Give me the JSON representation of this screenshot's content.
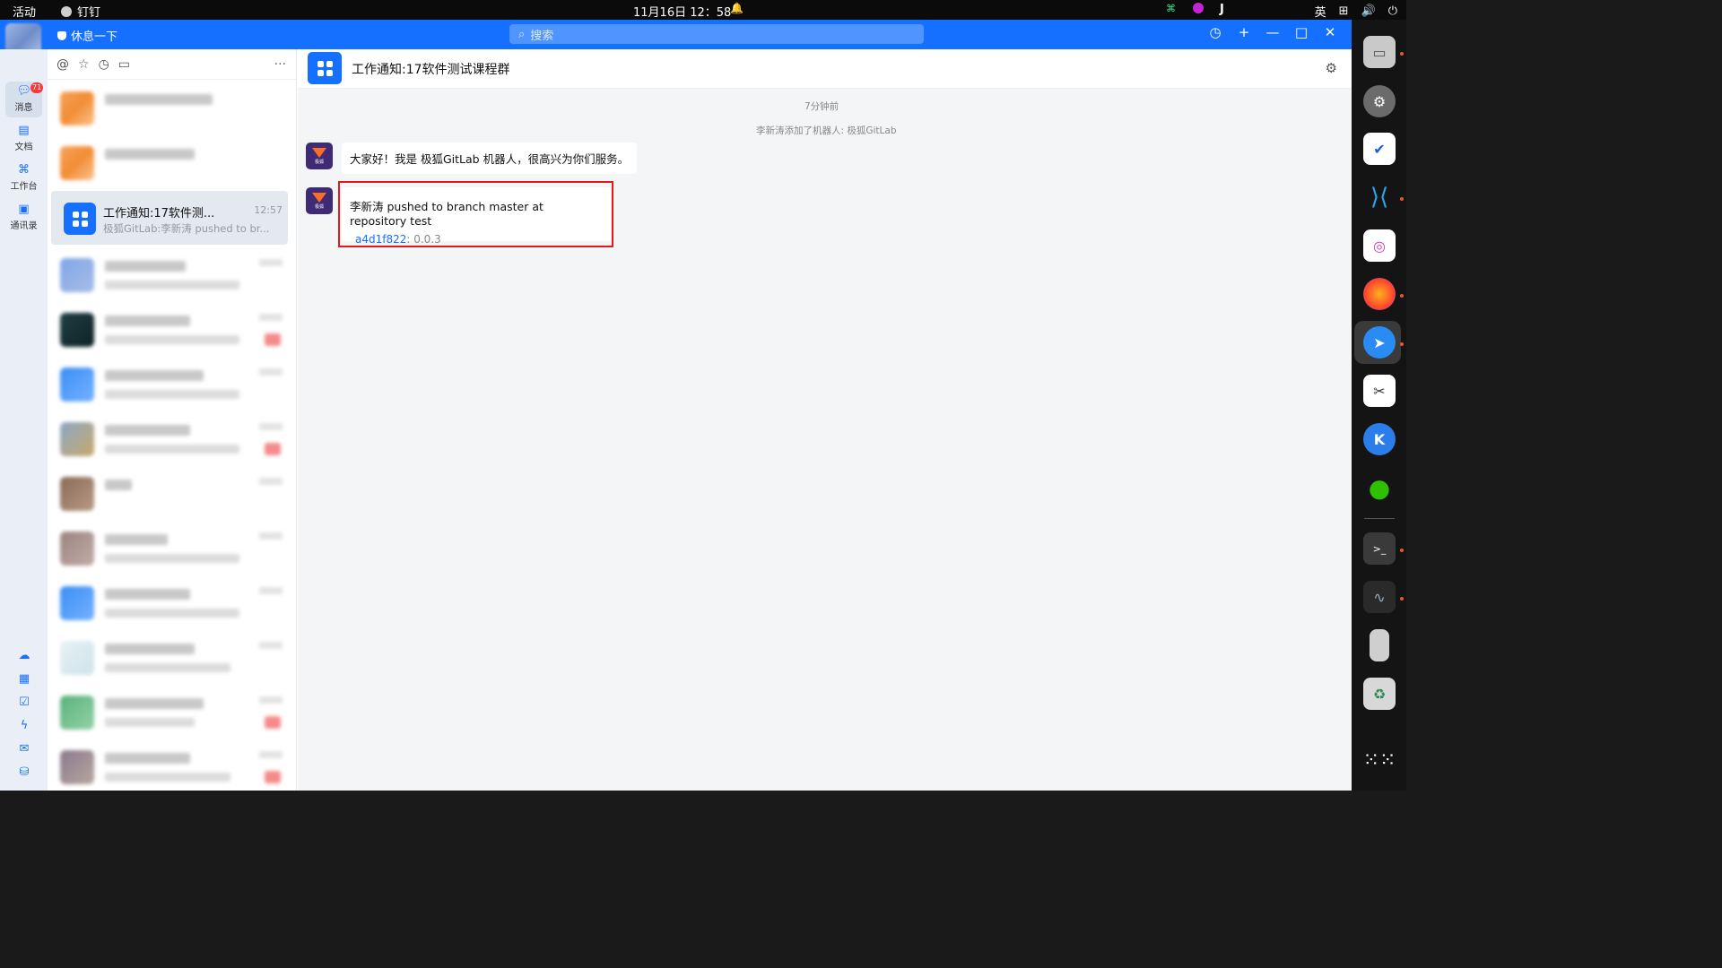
{
  "topbar": {
    "activities": "活动",
    "app_name": "钉钉",
    "clock": "11月16日  12：58",
    "input_method": "英"
  },
  "titlebar": {
    "status": "休息一下",
    "search_placeholder": "搜索"
  },
  "rail": {
    "items": [
      {
        "label": "消息",
        "icon": "message-icon",
        "badge": "71"
      },
      {
        "label": "文档",
        "icon": "document-icon"
      },
      {
        "label": "工作台",
        "icon": "workbench-icon"
      },
      {
        "label": "通讯录",
        "icon": "contacts-icon"
      }
    ],
    "tools": [
      "cloud-icon",
      "calendar-icon",
      "todo-icon",
      "lightning-icon",
      "mail-icon",
      "drive-icon"
    ]
  },
  "list": {
    "toolbar_icons": [
      "at-icon",
      "star-icon",
      "clock-icon",
      "file-icon"
    ],
    "selected": {
      "title": "工作通知:17软件测...",
      "time": "12:57",
      "preview": "极狐GitLab:李新涛 pushed to br..."
    }
  },
  "chat": {
    "title": "工作通知:17软件测试课程群",
    "time_divider": "7分钟前",
    "system_notice": "李新涛添加了机器人: 极狐GitLab",
    "bot_avatar_label": "极狐",
    "messages": [
      {
        "text": "大家好！我是 极狐GitLab 机器人，很高兴为你们服务。"
      },
      {
        "text": "李新涛 pushed to branch master at repository test",
        "commit": "a4d1f822",
        "version": ": 0.0.3"
      }
    ]
  },
  "dock": {
    "apps": [
      "files-icon",
      "settings-icon",
      "wps-icon",
      "vscode-icon",
      "ide-icon",
      "firefox-icon",
      "dingtalk-icon",
      "screenshot-icon",
      "kdocs-icon",
      "wechat-icon",
      "terminal-icon",
      "system-monitor-icon",
      "phone-icon",
      "trash-icon",
      "app-grid-icon"
    ]
  },
  "colors": {
    "accent": "#1570ff",
    "highlight": "#e31a1a",
    "gitlab_bg": "#3f2a76",
    "gitlab_fox": "#fc6d26"
  }
}
